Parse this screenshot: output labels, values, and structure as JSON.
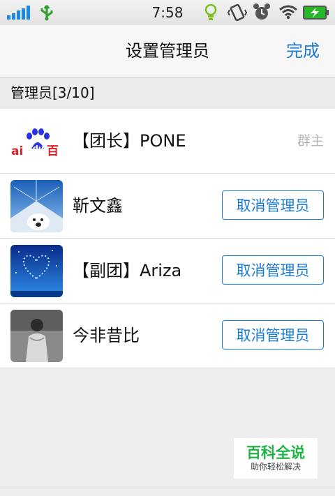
{
  "status_bar": {
    "time": "7:58"
  },
  "nav": {
    "title": "设置管理员",
    "done_label": "完成"
  },
  "section": {
    "title": "管理员[3/10]"
  },
  "members": [
    {
      "name": "【团长】PONE",
      "role": "群主",
      "avatar": "baidu-logo"
    },
    {
      "name": "靳文鑫",
      "action": "取消管理员",
      "avatar": "polar-bear-photo"
    },
    {
      "name": "【副团】Ariza",
      "action": "取消管理员",
      "avatar": "blue-heart-photo"
    },
    {
      "name": "今非昔比",
      "action": "取消管理员",
      "avatar": "gray-person-photo"
    }
  ],
  "watermark": {
    "title": "百科全说",
    "subtitle": "助你轻松解决"
  },
  "colors": {
    "accent": "#1a7bd9",
    "signal": "#1e88e5",
    "usb": "#2e9e2e",
    "battery": "#27b827"
  }
}
